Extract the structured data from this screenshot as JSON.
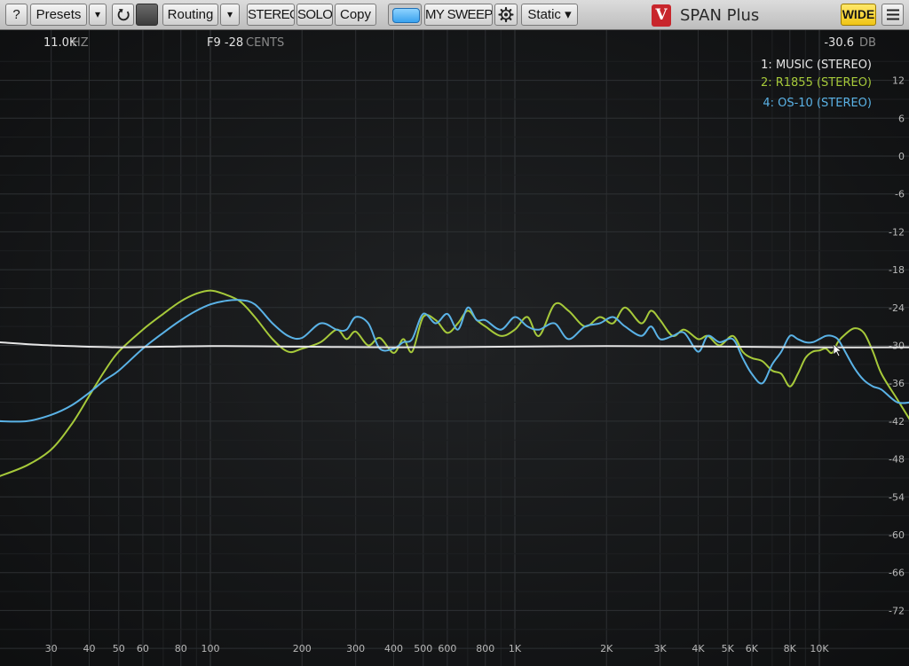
{
  "toolbar": {
    "help_label": "?",
    "presets_label": "Presets",
    "routing_label": "Routing",
    "stereo_label": "STEREO",
    "solo_label": "SOLO",
    "copy_label": "Copy",
    "sweep_label": "MY SWEEP",
    "static_label": "Static ▾",
    "dropdown_glyph": "▾",
    "brand_logo_text": "V",
    "brand_title": "SPAN Plus",
    "wide_label": "WIDE",
    "icons": [
      "help",
      "dropdown-arrow",
      "undo-arrow",
      "gear",
      "hamburger-menu"
    ]
  },
  "readout": {
    "freq_value": "11.0K",
    "freq_unit": "HZ",
    "note_value": "F9 -28",
    "note_unit": "CENTS",
    "level_value": "-30.6",
    "level_unit": "DB"
  },
  "chart_data": {
    "type": "line",
    "x_scale": "log",
    "xlim": [
      20,
      20000
    ],
    "ylim": [
      -78,
      16
    ],
    "grid": true,
    "legend_position": "top-right",
    "x_ticks": [
      30,
      40,
      50,
      60,
      80,
      100,
      200,
      300,
      400,
      500,
      600,
      800,
      1000,
      2000,
      3000,
      4000,
      5000,
      6000,
      8000,
      10000
    ],
    "x_tick_labels": [
      "30",
      "40",
      "50",
      "60",
      "80",
      "100",
      "200",
      "300",
      "400",
      "500",
      "600",
      "800",
      "1K",
      "2K",
      "3K",
      "4K",
      "5K",
      "6K",
      "8K",
      "10K"
    ],
    "y_ticks": [
      12,
      6,
      0,
      -6,
      -12,
      -18,
      -24,
      -30,
      -36,
      -42,
      -48,
      -54,
      -60,
      -66,
      -72
    ],
    "y_tick_labels": [
      "12",
      "6",
      "0",
      "-6",
      "-12",
      "-18",
      "-24",
      "-30",
      "-36",
      "-42",
      "-48",
      "-54",
      "-60",
      "-66",
      "-72"
    ],
    "series": [
      {
        "name": "1: MUSIC (STEREO)",
        "color": "#e6e6e6",
        "x": [
          20,
          30,
          50,
          100,
          200,
          400,
          1000,
          2000,
          5000,
          10000,
          20000
        ],
        "y": [
          -29.5,
          -30.0,
          -30.3,
          -30.1,
          -30.2,
          -30.3,
          -30.2,
          -30.1,
          -30.2,
          -30.3,
          -30.3
        ]
      },
      {
        "name": "2: R1855 (STEREO)",
        "color": "#a6c93a",
        "x": [
          20,
          25,
          30,
          35,
          40,
          45,
          50,
          60,
          70,
          80,
          90,
          100,
          110,
          125,
          140,
          160,
          180,
          200,
          230,
          260,
          280,
          300,
          330,
          360,
          400,
          430,
          460,
          500,
          550,
          600,
          650,
          700,
          750,
          800,
          900,
          1000,
          1100,
          1200,
          1350,
          1500,
          1700,
          1900,
          2100,
          2300,
          2600,
          2800,
          3000,
          3300,
          3600,
          4000,
          4300,
          4700,
          5200,
          5600,
          6000,
          6500,
          7000,
          7500,
          8000,
          8500,
          9000,
          9500,
          10000,
          10500,
          11000,
          11500,
          12000,
          13000,
          14000,
          15000,
          16000,
          18000,
          20000
        ],
        "y": [
          -50.8,
          -49.0,
          -46.5,
          -42.5,
          -38.0,
          -34.0,
          -31.0,
          -27.5,
          -25.0,
          -23.0,
          -21.8,
          -21.3,
          -21.8,
          -23.0,
          -25.5,
          -29.0,
          -31.0,
          -30.5,
          -29.5,
          -27.5,
          -29.0,
          -27.8,
          -30.0,
          -28.8,
          -31.2,
          -29.0,
          -31.0,
          -25.5,
          -26.0,
          -28.0,
          -26.5,
          -24.5,
          -26.0,
          -27.0,
          -28.5,
          -27.5,
          -25.5,
          -28.5,
          -23.5,
          -24.5,
          -27.0,
          -25.5,
          -26.5,
          -24.0,
          -26.5,
          -24.5,
          -26.0,
          -28.5,
          -27.5,
          -29.0,
          -28.5,
          -30.0,
          -28.5,
          -31.0,
          -32.0,
          -32.5,
          -34.0,
          -34.5,
          -36.5,
          -34.5,
          -32.0,
          -31.0,
          -30.8,
          -30.5,
          -31.2,
          -29.5,
          -28.5,
          -27.3,
          -28.0,
          -31.0,
          -34.5,
          -38.5,
          -42.0
        ]
      },
      {
        "name": "4: OS-10 (STEREO)",
        "color": "#5ab2e6",
        "x": [
          20,
          25,
          30,
          35,
          40,
          45,
          50,
          60,
          70,
          80,
          90,
          100,
          110,
          125,
          140,
          160,
          180,
          200,
          230,
          260,
          280,
          300,
          330,
          360,
          400,
          430,
          460,
          500,
          550,
          600,
          650,
          700,
          750,
          800,
          900,
          1000,
          1100,
          1200,
          1350,
          1500,
          1700,
          1900,
          2100,
          2300,
          2600,
          2800,
          3000,
          3300,
          3600,
          4000,
          4300,
          4700,
          5200,
          5600,
          6000,
          6500,
          7000,
          7500,
          8000,
          8500,
          9000,
          9500,
          10000,
          10500,
          11000,
          11500,
          12000,
          13000,
          14000,
          15000,
          16000,
          18000,
          20000
        ],
        "y": [
          -42.0,
          -42.0,
          -41.0,
          -39.5,
          -37.5,
          -35.5,
          -34.0,
          -30.5,
          -28.0,
          -26.0,
          -24.5,
          -23.5,
          -23.0,
          -22.8,
          -23.5,
          -26.5,
          -28.5,
          -28.8,
          -26.5,
          -27.5,
          -27.5,
          -25.5,
          -26.5,
          -30.5,
          -30.5,
          -29.5,
          -29.0,
          -25.0,
          -26.5,
          -25.0,
          -27.5,
          -24.0,
          -26.0,
          -26.0,
          -27.5,
          -25.5,
          -27.0,
          -27.5,
          -26.5,
          -29.0,
          -27.0,
          -26.5,
          -25.5,
          -27.0,
          -28.5,
          -27.0,
          -29.0,
          -28.5,
          -28.0,
          -31.0,
          -28.5,
          -29.5,
          -29.0,
          -32.0,
          -34.5,
          -36.0,
          -33.0,
          -31.0,
          -28.5,
          -29.0,
          -29.5,
          -29.5,
          -29.0,
          -28.5,
          -28.5,
          -29.0,
          -30.5,
          -33.5,
          -35.5,
          -36.5,
          -37.0,
          -39.0,
          -39.0
        ]
      }
    ]
  }
}
